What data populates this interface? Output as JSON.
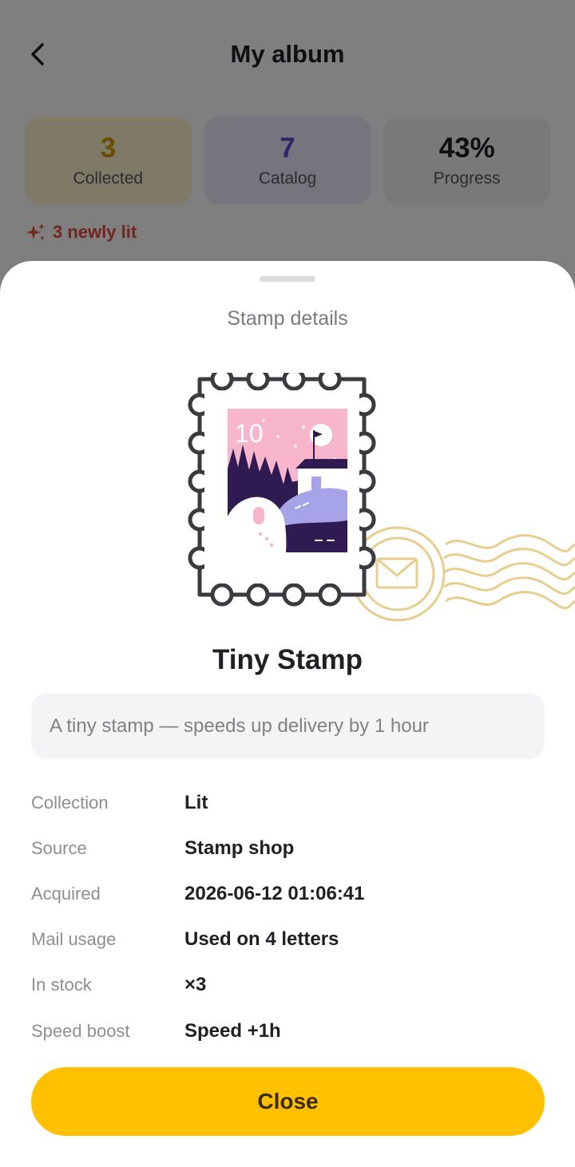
{
  "header": {
    "title": "My album"
  },
  "stats": [
    {
      "value": "3",
      "label": "Collected"
    },
    {
      "value": "7",
      "label": "Catalog"
    },
    {
      "value": "43%",
      "label": "Progress"
    }
  ],
  "newly_lit": "3 newly lit",
  "sheet": {
    "title": "Stamp details",
    "stamp_face_value": "10",
    "item_name": "Tiny Stamp",
    "description": "A tiny stamp — speeds up delivery by 1 hour",
    "details": [
      {
        "key": "Collection",
        "value": "Lit"
      },
      {
        "key": "Source",
        "value": "Stamp shop"
      },
      {
        "key": "Acquired",
        "value": "2026-06-12 01:06:41"
      },
      {
        "key": "Mail usage",
        "value": "Used on 4 letters"
      },
      {
        "key": "In stock",
        "value": "×3"
      },
      {
        "key": "Speed boost",
        "value": "Speed +1h"
      }
    ],
    "close_label": "Close"
  },
  "colors": {
    "accent": "#ffc000",
    "collected": "#d49a00",
    "catalog": "#5a4bd1",
    "newly": "#e24a3b",
    "postmark": "#e9cd8f"
  },
  "icons": {
    "back": "chevron-left-icon",
    "sparkle": "sparkle-icon",
    "postmark": "postmark-icon"
  }
}
